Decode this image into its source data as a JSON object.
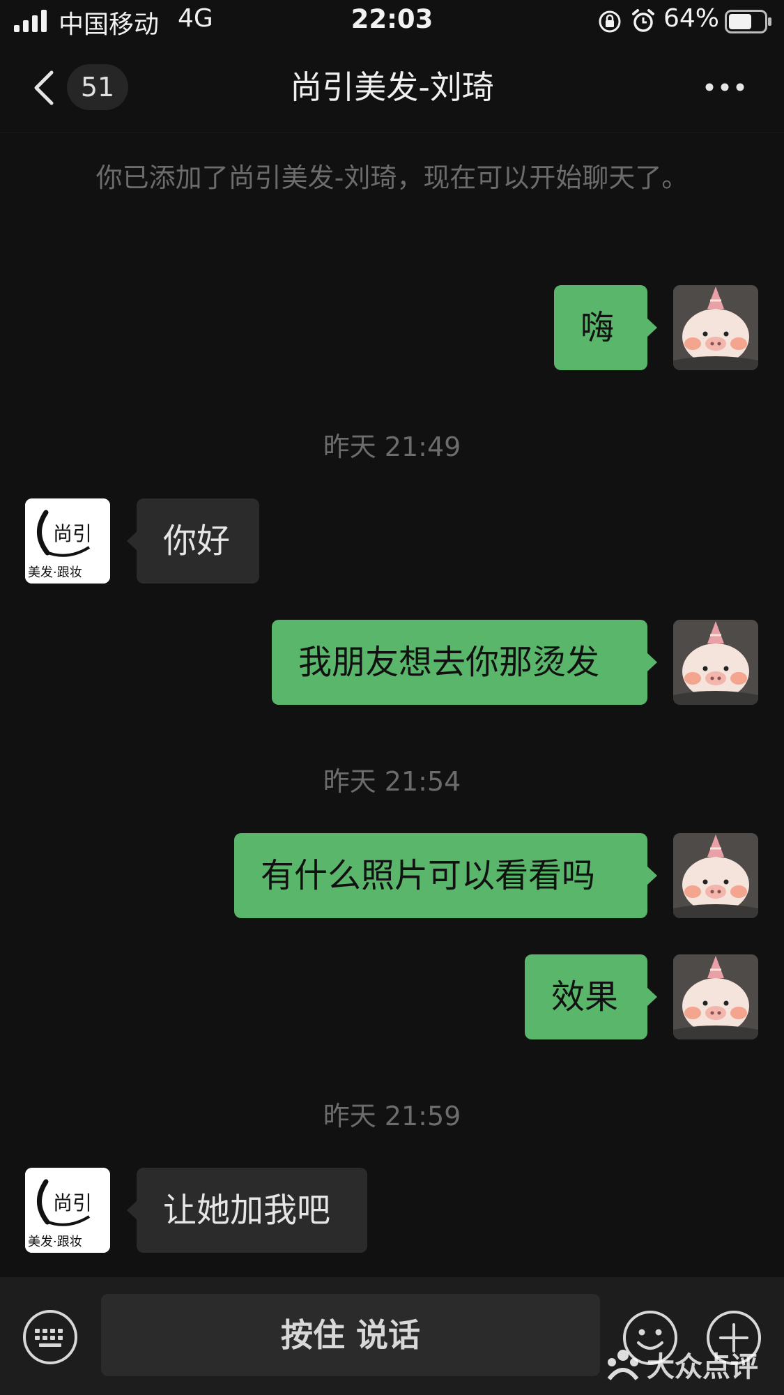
{
  "status_bar": {
    "carrier": "中国移动",
    "network": "4G",
    "time": "22:03",
    "battery_percent": "64%",
    "battery_level": 0.64
  },
  "nav": {
    "unread_count": "51",
    "title": "尚引美发-刘琦"
  },
  "system_notice": "你已添加了尚引美发-刘琦，现在可以开始聊天了。",
  "messages": [
    {
      "sender": "me",
      "text": "嗨"
    },
    {
      "timestamp": "昨天 21:49"
    },
    {
      "sender": "them",
      "text": "你好"
    },
    {
      "sender": "me",
      "text": "我朋友想去你那烫发"
    },
    {
      "timestamp": "昨天 21:54"
    },
    {
      "sender": "me",
      "text": "有什么照片可以看看吗"
    },
    {
      "sender": "me",
      "text": "效果"
    },
    {
      "timestamp": "昨天 21:59"
    },
    {
      "sender": "them",
      "text": "让她加我吧"
    }
  ],
  "avatars": {
    "me": "pig-avatar-icon",
    "them": "shop-logo-avatar",
    "shop_logo_text_top": "尚引",
    "shop_logo_text_bottom": "美发·跟妆"
  },
  "input_bar": {
    "hold_to_talk_label": "按住 说话",
    "icons": [
      "keyboard-icon",
      "emoji-icon",
      "plus-icon"
    ]
  },
  "watermark": "大众点评",
  "colors": {
    "background": "#111111",
    "my_bubble": "#5ab66a",
    "their_bubble": "#2b2b2b",
    "muted_text": "#6c6c6c"
  }
}
